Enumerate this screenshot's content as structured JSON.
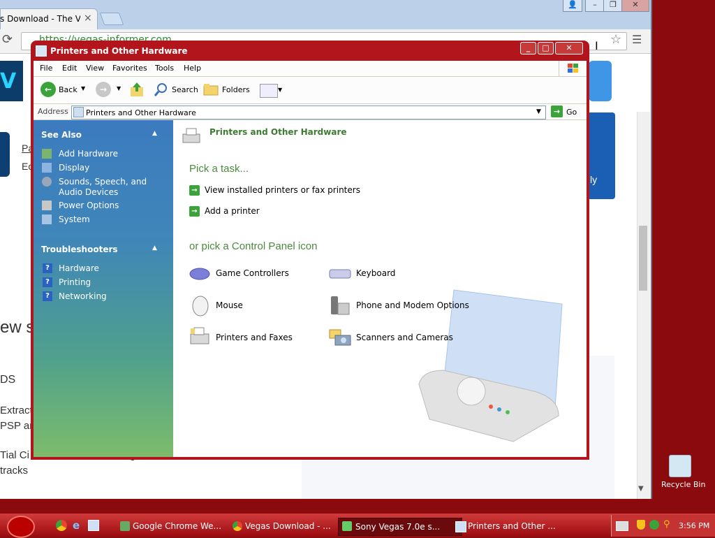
{
  "browser": {
    "tab_title": "s Download - The Vegas",
    "tab_close": "×",
    "url": "https://vegas-informer.com",
    "window_buttons": {
      "user": "👤",
      "minimize": "–",
      "maximize": "❐",
      "close": "✕"
    }
  },
  "webpage_bg": {
    "fragments": [
      "Pa",
      "Ec",
      "ew s",
      "ly",
      "DS",
      "Extract",
      "PSP ar",
      "Tial Ci",
      "tracks",
      "g"
    ]
  },
  "explorer": {
    "title": "Printers and Other Hardware",
    "menu": [
      "File",
      "Edit",
      "View",
      "Favorites",
      "Tools",
      "Help"
    ],
    "toolbar": {
      "back": "Back",
      "search": "Search",
      "folders": "Folders"
    },
    "address_label": "Address",
    "address_value": "Printers and Other Hardware",
    "go_label": "Go",
    "left_pane": {
      "see_also_title": "See Also",
      "see_also": [
        "Add Hardware",
        "Display",
        "Sounds, Speech, and",
        "Audio Devices",
        "Power Options",
        "System"
      ],
      "troubleshooters_title": "Troubleshooters",
      "troubleshooters": [
        "Hardware",
        "Printing",
        "Networking"
      ]
    },
    "right_pane": {
      "header": "Printers and Other Hardware",
      "pick_task": "Pick a task...",
      "tasks": [
        "View installed printers or fax printers",
        "Add a printer"
      ],
      "pick_icon": "or pick a Control Panel icon",
      "icons": [
        {
          "label": "Game Controllers",
          "icon": "gamepad-icon"
        },
        {
          "label": "Keyboard",
          "icon": "keyboard-icon"
        },
        {
          "label": "Mouse",
          "icon": "mouse-icon"
        },
        {
          "label": "Phone and Modem Options",
          "icon": "phone-icon"
        },
        {
          "label": "Printers and Faxes",
          "icon": "printer-icon"
        },
        {
          "label": "Scanners and Cameras",
          "icon": "scanner-icon"
        }
      ]
    }
  },
  "desktop": {
    "recycle_bin": "Recycle Bin"
  },
  "taskbar": {
    "items": [
      "Google Chrome We...",
      "Vegas Download - ...",
      "Sony Vegas 7.0e s...",
      "Printers and Other ..."
    ],
    "clock": "3:56 PM"
  }
}
